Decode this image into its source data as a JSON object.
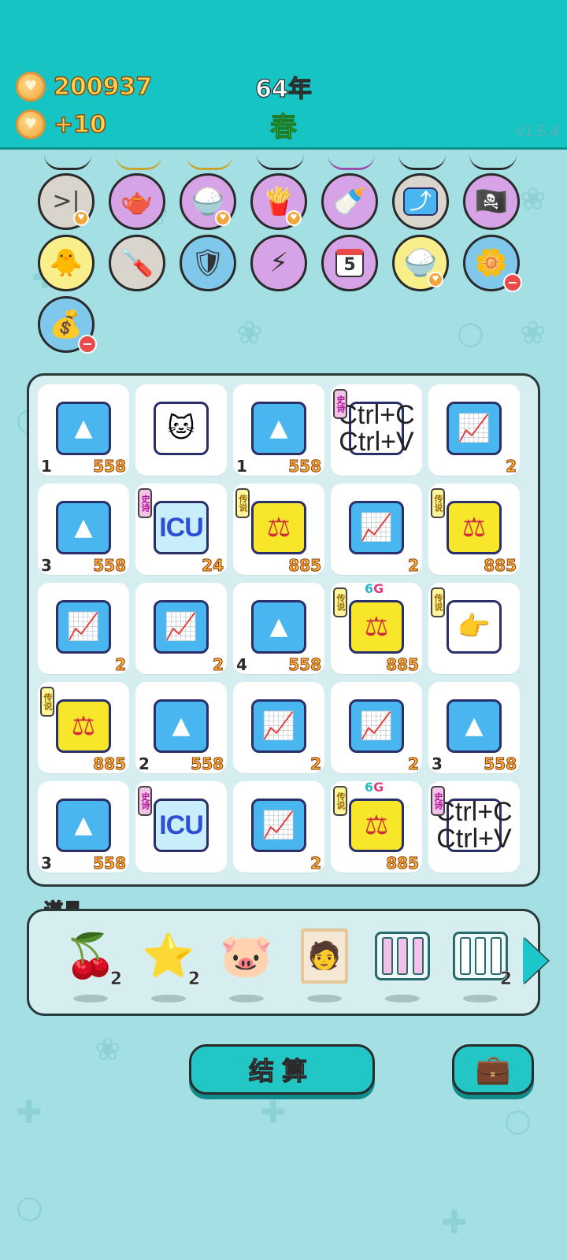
{
  "header": {
    "coins": "200937",
    "income": "+10",
    "year": "64年",
    "season": "春",
    "version": "v1.5.4"
  },
  "traits": [
    {
      "icon": "skip-end-icon",
      "glyph": ">|",
      "color": "grey",
      "badge": "heart"
    },
    {
      "icon": "gravy-boat-icon",
      "glyph": "🫖",
      "color": "purple",
      "badge": ""
    },
    {
      "icon": "rice-bowl-icon",
      "glyph": "🍚",
      "color": "purple",
      "badge": "heart"
    },
    {
      "icon": "french-fries-icon",
      "glyph": "🍟",
      "color": "purple",
      "badge": "heart"
    },
    {
      "icon": "breast-pump-icon",
      "glyph": "🍼",
      "color": "purple",
      "badge": ""
    },
    {
      "icon": "upward-arrow-icon",
      "glyph": "⤴",
      "color": "grey",
      "badge": ""
    },
    {
      "icon": "eye-patch-icon",
      "glyph": "🏴‍☠️",
      "color": "purple",
      "badge": ""
    },
    {
      "icon": "chick-egg-icon",
      "glyph": "🐥",
      "color": "yellow",
      "badge": ""
    },
    {
      "icon": "screwdriver-icon",
      "glyph": "🪛",
      "color": "grey",
      "badge": ""
    },
    {
      "icon": "shield-wrench-icon",
      "glyph": "🛡",
      "color": "blue",
      "badge": ""
    },
    {
      "icon": "lightning-box-icon",
      "glyph": "⚡",
      "color": "purple",
      "badge": ""
    },
    {
      "icon": "calendar-icon",
      "glyph": "5",
      "color": "purple",
      "badge": ""
    },
    {
      "icon": "rice-bowl-icon",
      "glyph": "🍚",
      "color": "yellow",
      "badge": "heart"
    },
    {
      "icon": "potted-flower-icon",
      "glyph": "🌼",
      "color": "blue",
      "badge": "minus"
    },
    {
      "icon": "money-sack-icon",
      "glyph": "💰",
      "color": "blue",
      "badge": "minus"
    }
  ],
  "board": [
    {
      "type": "gold",
      "left": "1",
      "right": "558",
      "tag": "",
      "sixg": false
    },
    {
      "type": "cat",
      "left": "",
      "right": "",
      "tag": "",
      "sixg": false
    },
    {
      "type": "gold",
      "left": "1",
      "right": "558",
      "tag": "",
      "sixg": false
    },
    {
      "type": "copy",
      "left": "",
      "right": "",
      "tag": "史诗",
      "sixg": false
    },
    {
      "type": "chart",
      "left": "",
      "right": "2",
      "tag": "",
      "sixg": false
    },
    {
      "type": "gold",
      "left": "3",
      "right": "558",
      "tag": "",
      "sixg": false
    },
    {
      "type": "icu",
      "left": "",
      "right": "24",
      "tag": "史诗",
      "sixg": false
    },
    {
      "type": "law",
      "left": "",
      "right": "885",
      "tag": "传说",
      "sixg": false
    },
    {
      "type": "chart",
      "left": "",
      "right": "2",
      "tag": "",
      "sixg": false
    },
    {
      "type": "law",
      "left": "",
      "right": "885",
      "tag": "传说",
      "sixg": false
    },
    {
      "type": "chart",
      "left": "",
      "right": "2",
      "tag": "",
      "sixg": false
    },
    {
      "type": "chart",
      "left": "",
      "right": "2",
      "tag": "",
      "sixg": false
    },
    {
      "type": "gold",
      "left": "4",
      "right": "558",
      "tag": "",
      "sixg": false
    },
    {
      "type": "law",
      "left": "",
      "right": "885",
      "tag": "传说",
      "sixg": true
    },
    {
      "type": "hand",
      "left": "",
      "right": "",
      "tag": "传说",
      "sixg": false
    },
    {
      "type": "law",
      "left": "",
      "right": "885",
      "tag": "传说",
      "sixg": false
    },
    {
      "type": "gold",
      "left": "2",
      "right": "558",
      "tag": "",
      "sixg": false
    },
    {
      "type": "chart",
      "left": "",
      "right": "2",
      "tag": "",
      "sixg": false
    },
    {
      "type": "chart",
      "left": "",
      "right": "2",
      "tag": "",
      "sixg": false
    },
    {
      "type": "gold",
      "left": "3",
      "right": "558",
      "tag": "",
      "sixg": false
    },
    {
      "type": "gold",
      "left": "3",
      "right": "558",
      "tag": "",
      "sixg": false
    },
    {
      "type": "icu",
      "left": "",
      "right": "",
      "tag": "史诗",
      "sixg": false
    },
    {
      "type": "chart",
      "left": "",
      "right": "2",
      "tag": "",
      "sixg": false
    },
    {
      "type": "law",
      "left": "",
      "right": "885",
      "tag": "传说",
      "sixg": true
    },
    {
      "type": "copy",
      "left": "",
      "right": "",
      "tag": "史诗",
      "sixg": false
    }
  ],
  "labels": {
    "icu": "ICU",
    "copy_line1": "Ctrl+C",
    "copy_line2": "Ctrl+V",
    "sixg_six": "6",
    "sixg_g": "G"
  },
  "items": {
    "title": "道具",
    "list": [
      {
        "icon": "lychee-icon",
        "glyph": "🍒",
        "count": "2"
      },
      {
        "icon": "star-icon",
        "glyph": "⭐",
        "count": "2"
      },
      {
        "icon": "piggy-bank-icon",
        "glyph": "🐷",
        "count": ""
      },
      {
        "icon": "portrait-frame-icon",
        "glyph": "🧑",
        "count": ""
      },
      {
        "icon": "epic-slots-icon",
        "glyph": "",
        "count": ""
      },
      {
        "icon": "empty-slots-icon",
        "glyph": "",
        "count": "2"
      }
    ]
  },
  "buttons": {
    "settle": "结算",
    "bag_icon": "briefcase-icon"
  },
  "colors": {
    "header_bg": "#16c4c4",
    "page_bg": "#a3dfe3",
    "coin_text": "#ffd34d",
    "season_text": "#3bd14f"
  }
}
